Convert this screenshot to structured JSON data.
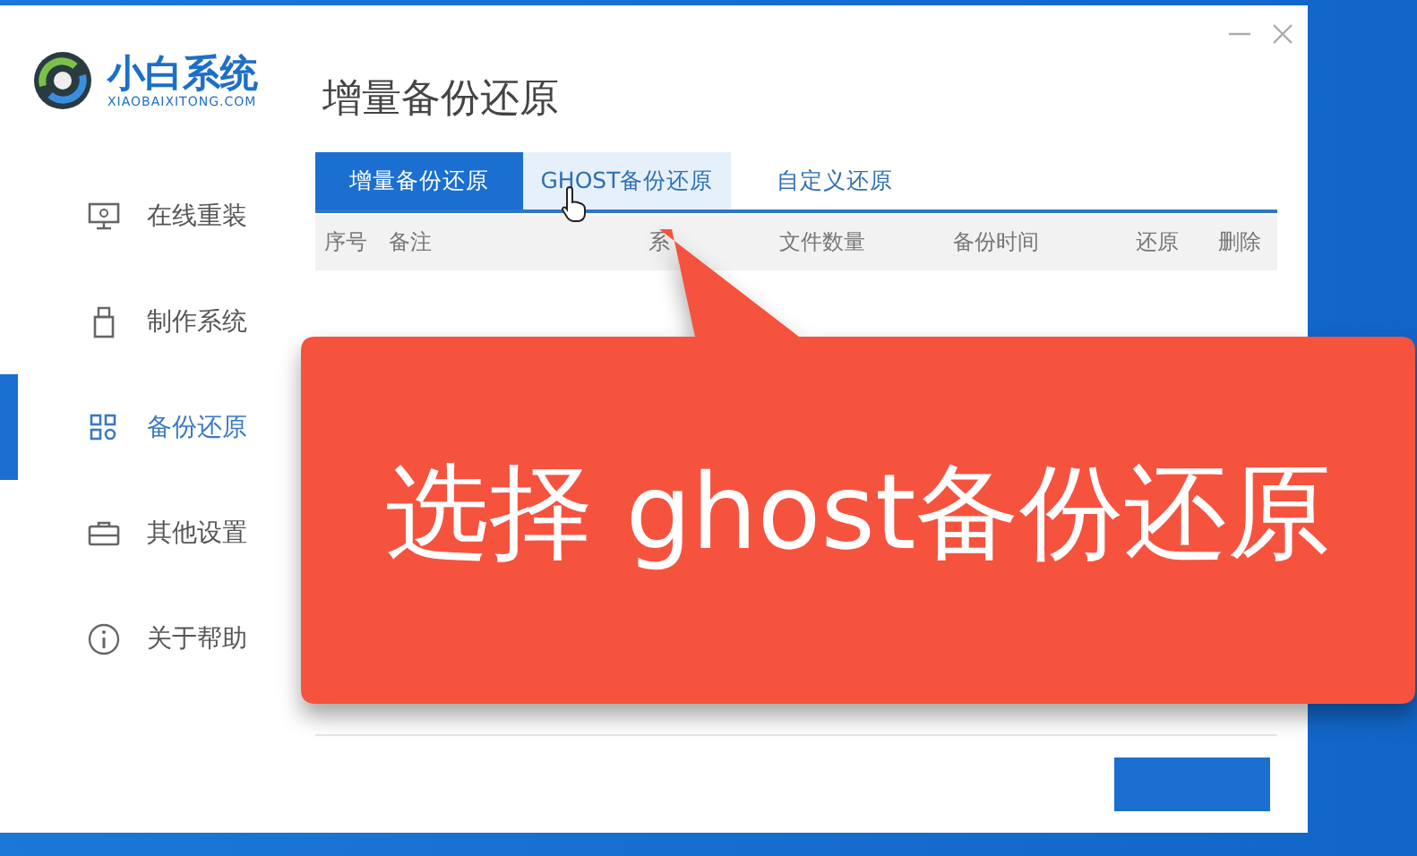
{
  "logo": {
    "name": "小白系统",
    "site": "XIAOBAIXITONG.COM"
  },
  "sidebar": {
    "items": [
      {
        "label": "在线重装",
        "kind": "monitor",
        "selected": false
      },
      {
        "label": "制作系统",
        "kind": "usb",
        "selected": false
      },
      {
        "label": "备份还原",
        "kind": "grid",
        "selected": true
      },
      {
        "label": "其他设置",
        "kind": "case",
        "selected": false
      },
      {
        "label": "关于帮助",
        "kind": "info",
        "selected": false
      }
    ]
  },
  "page_title": "增量备份还原",
  "tabs": [
    {
      "label": "增量备份还原",
      "selected": true,
      "hovered": false
    },
    {
      "label": "GHOST备份还原",
      "selected": false,
      "hovered": true
    },
    {
      "label": "自定义还原",
      "selected": false,
      "hovered": false
    }
  ],
  "table": {
    "columns": [
      "序号",
      "备注",
      "系",
      "文件数量",
      "备份时间",
      "还原",
      "删除"
    ]
  },
  "callout": {
    "text": "选择 ghost备份还原"
  }
}
